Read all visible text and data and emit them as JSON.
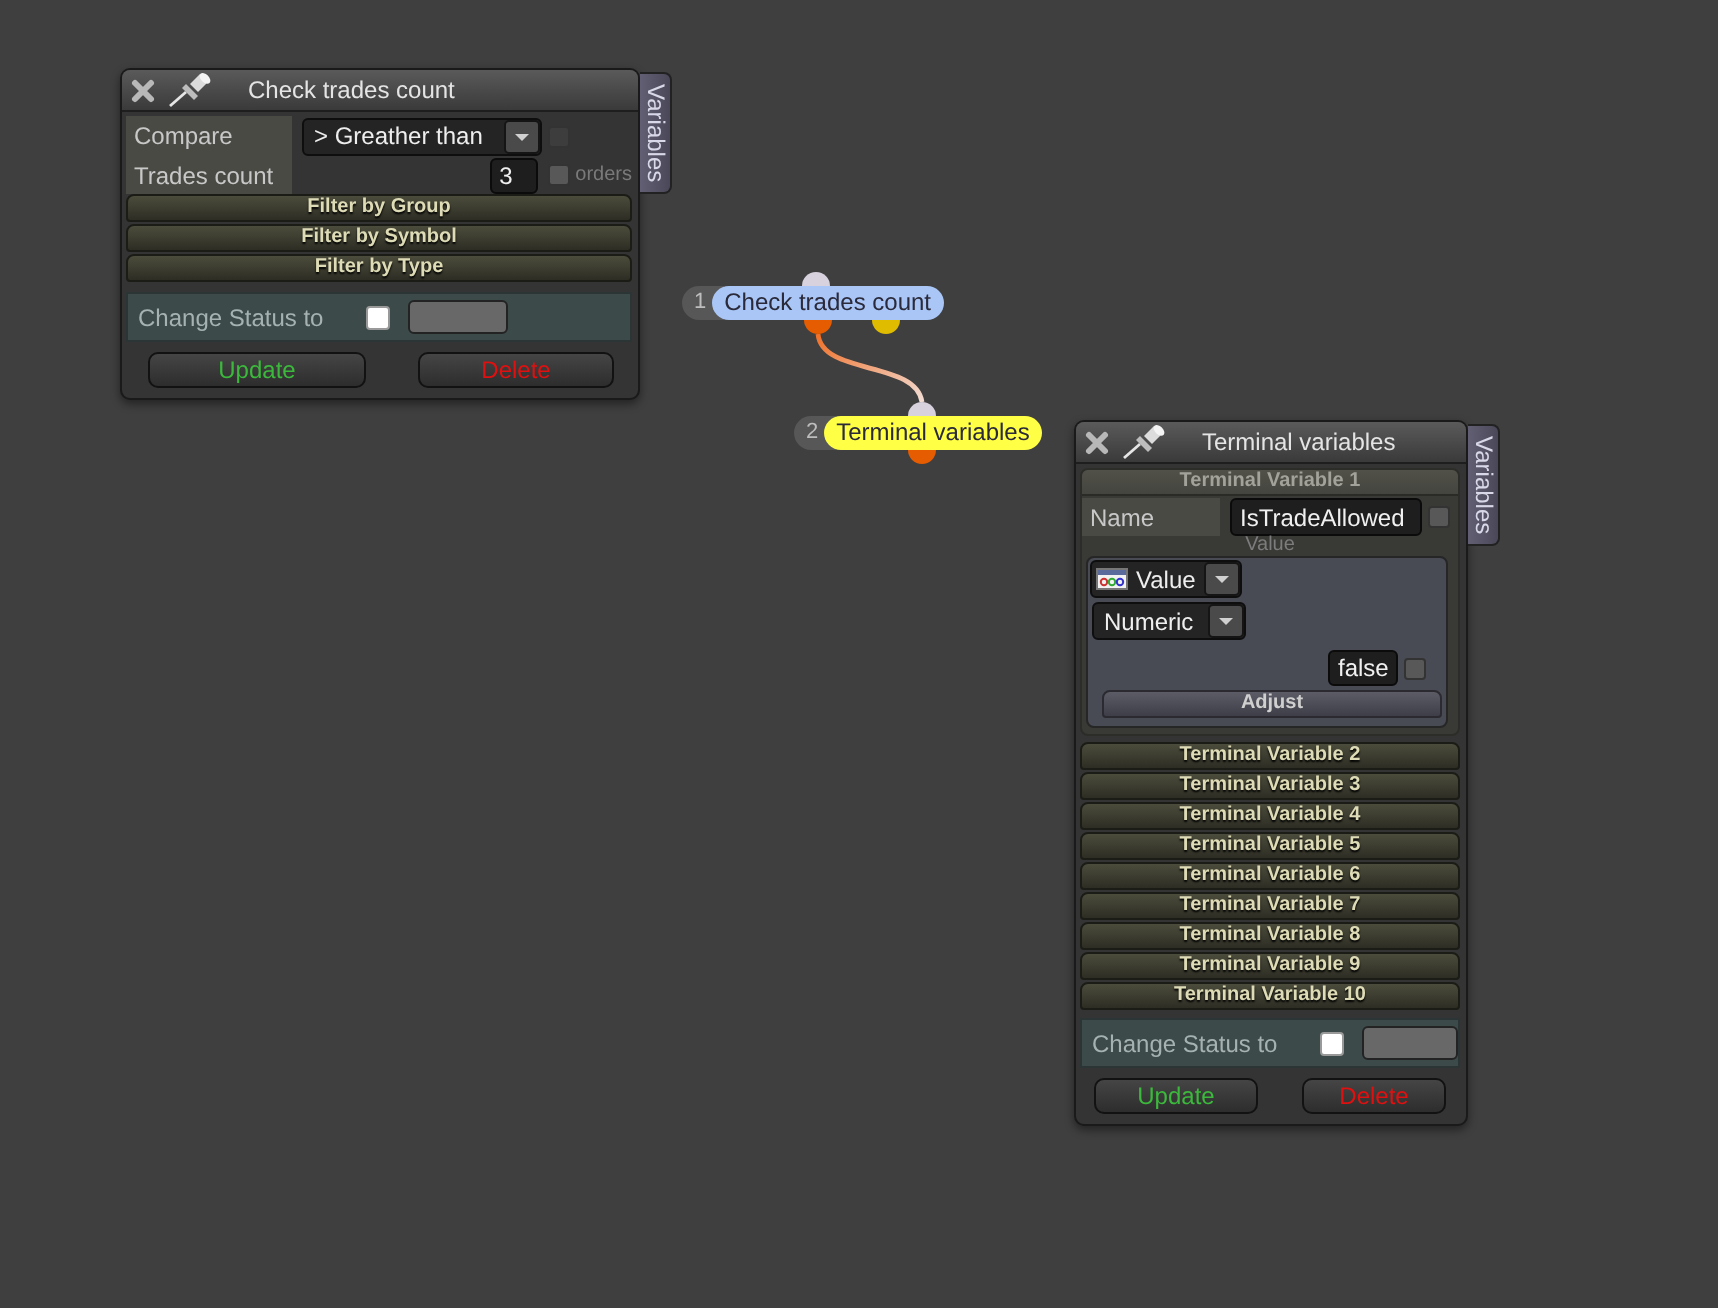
{
  "trades_panel": {
    "title": "Check trades count",
    "side_tab": "Variables",
    "compare": {
      "label": "Compare",
      "value": "> Greather than",
      "checked": false,
      "disabled": true
    },
    "count": {
      "label": "Trades count",
      "value": "3",
      "unit": "orders",
      "checked": false
    },
    "filters": [
      {
        "label": "Filter by Group",
        "expanded": false
      },
      {
        "label": "Filter by Symbol",
        "expanded": false
      },
      {
        "label": "Filter by Type",
        "expanded": false
      }
    ],
    "status": {
      "label": "Change Status to",
      "checked": false
    },
    "buttons": [
      {
        "label": "Update",
        "kind": "update"
      },
      {
        "label": "Delete",
        "kind": "delete"
      }
    ]
  },
  "nodes": [
    {
      "number": "1",
      "label": "Check trades count",
      "color": "#a9c6f6",
      "outputs": [
        {
          "color": "#e65c00"
        },
        {
          "color": "#e0bc00"
        }
      ]
    },
    {
      "number": "2",
      "label": "Terminal variables",
      "color": "#ffff45",
      "outputs": [
        {
          "color": "#e65c00"
        }
      ]
    }
  ],
  "variables_panel": {
    "title": "Terminal variables",
    "side_tab": "Variables",
    "variables": [
      {
        "label": "Terminal Variable 1",
        "expanded": true,
        "name_label": "Name",
        "name": "IsTradeAllowed",
        "name_checked": false,
        "value_caption": "Value",
        "source": "Value",
        "type": "Numeric",
        "value": "false",
        "value_checked": false,
        "action": "Adjust"
      },
      {
        "label": "Terminal Variable 2",
        "expanded": false
      },
      {
        "label": "Terminal Variable 3",
        "expanded": false
      },
      {
        "label": "Terminal Variable 4",
        "expanded": false
      },
      {
        "label": "Terminal Variable 5",
        "expanded": false
      },
      {
        "label": "Terminal Variable 6",
        "expanded": false
      },
      {
        "label": "Terminal Variable 7",
        "expanded": false
      },
      {
        "label": "Terminal Variable 8",
        "expanded": false
      },
      {
        "label": "Terminal Variable 9",
        "expanded": false
      },
      {
        "label": "Terminal Variable 10",
        "expanded": false
      }
    ],
    "status": {
      "label": "Change Status to",
      "checked": false
    },
    "buttons": [
      {
        "label": "Update",
        "kind": "update"
      },
      {
        "label": "Delete",
        "kind": "delete"
      }
    ]
  }
}
